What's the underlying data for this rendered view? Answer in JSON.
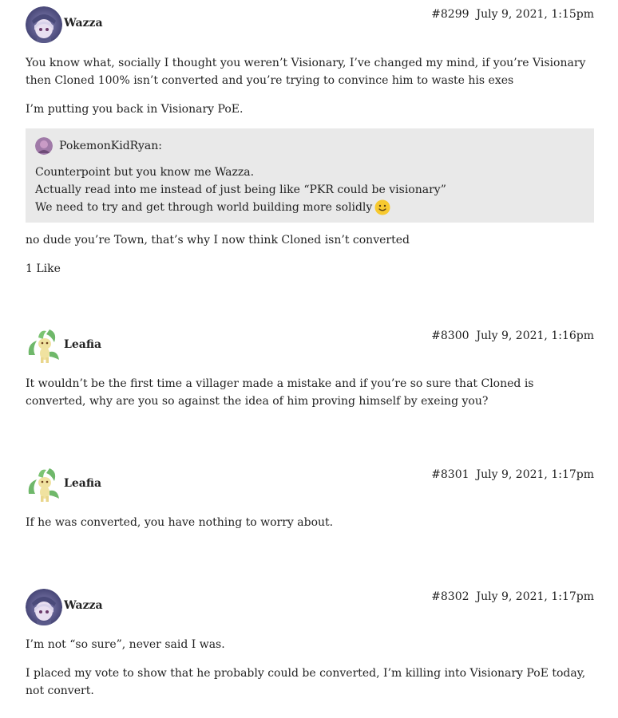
{
  "posts": [
    {
      "username": "Wazza",
      "number": "#8299",
      "date": "July 9, 2021, 1:15pm",
      "paragraphs": [
        "You know what, socially I thought you weren’t Visionary, I’ve changed my mind, if you’re Visionary then Cloned 100% isn’t converted and you’re trying to convince him to waste his exes",
        "I’m putting you back in Visionary PoE."
      ],
      "quote": {
        "author": "PokemonKidRyan:",
        "lines": [
          "Counterpoint but you know me Wazza.",
          "Actually read into me instead of just being like “PKR could be visionary”",
          "We need to try and get through world building more solidly"
        ],
        "emoji": "slightly-smiling-face-icon"
      },
      "after_quote": "no dude you’re Town, that’s why I now think Cloned isn’t converted",
      "likes": "1 Like"
    },
    {
      "username": "Leafia",
      "number": "#8300",
      "date": "July 9, 2021, 1:16pm",
      "paragraphs": [
        "It wouldn’t be the first time a villager made a mistake and if you’re so sure that Cloned is converted, why are you so against the idea of him proving himself by exeing you?"
      ]
    },
    {
      "username": "Leafia",
      "number": "#8301",
      "date": "July 9, 2021, 1:17pm",
      "paragraphs": [
        "If he was converted, you have nothing to worry about."
      ]
    },
    {
      "username": "Wazza",
      "number": "#8302",
      "date": "July 9, 2021, 1:17pm",
      "paragraphs": [
        "I’m not “so sure”, never said I was.",
        "I placed my vote to show that he probably could be converted, I’m killing into Visionary PoE today, not convert."
      ]
    }
  ]
}
